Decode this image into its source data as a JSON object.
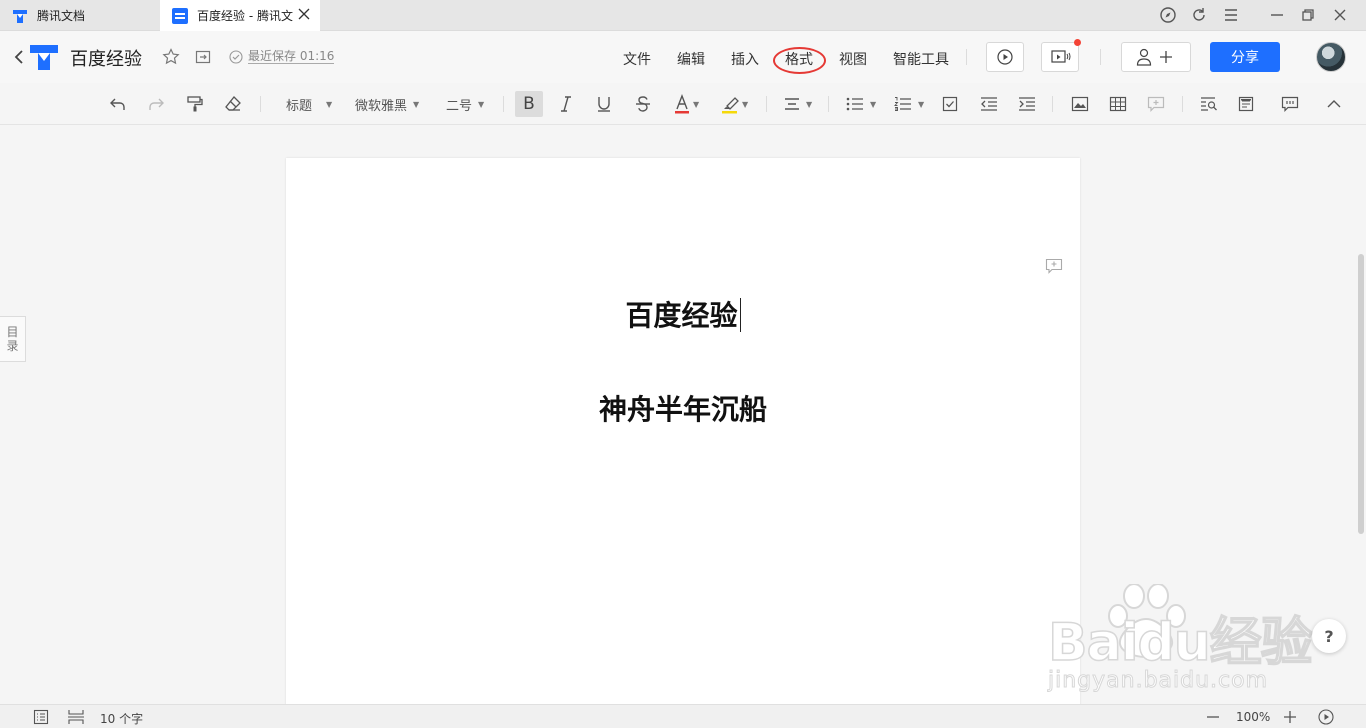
{
  "tabs": [
    {
      "label": "腾讯文档",
      "active": false
    },
    {
      "label": "百度经验 - 腾讯文",
      "active": true
    }
  ],
  "header": {
    "title": "百度经验",
    "save_status": "最近保存 01:16",
    "menu": [
      "文件",
      "编辑",
      "插入",
      "格式",
      "视图",
      "智能工具"
    ],
    "highlighted_menu": "格式",
    "share_label": "分享"
  },
  "toolbar": {
    "style_label": "标题",
    "font_label": "微软雅黑",
    "size_label": "二号",
    "bold_active": true
  },
  "document": {
    "lines": [
      "百度经验",
      "神舟半年沉船"
    ]
  },
  "sidebar": {
    "toc_label": "目录"
  },
  "status_bar": {
    "word_count": "10 个字",
    "zoom": "100%"
  },
  "watermark": {
    "brand": "Baidu经验",
    "url": "jingyan.baidu.com"
  },
  "help_label": "?",
  "colors": {
    "accent": "#1e6fff",
    "highlight_circle": "#e53935",
    "notification_dot": "#f44336"
  }
}
